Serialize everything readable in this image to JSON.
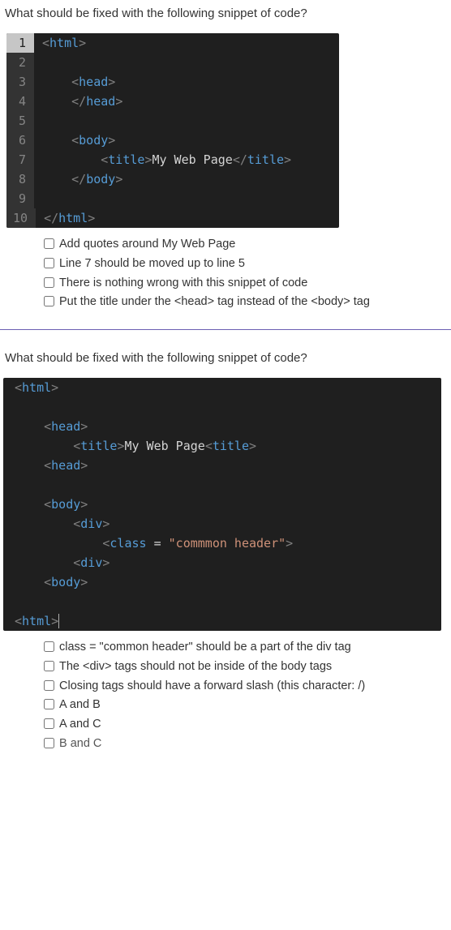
{
  "q1": {
    "prompt": "What should be fixed with the following snippet of code?",
    "code": {
      "lines": [
        "1",
        "2",
        "3",
        "4",
        "5",
        "6",
        "7",
        "8",
        "9",
        "10"
      ]
    },
    "options": [
      "Add quotes around My Web Page",
      "Line 7 should be moved up to line 5",
      "There is nothing wrong with this snippet of code",
      "Put the title under the <head> tag instead of the <body> tag"
    ]
  },
  "q2": {
    "prompt": "What should be fixed with the following snippet of code?",
    "options": [
      "class = \"common header\" should be a part of the div tag",
      "The <div> tags should not be inside of the body tags",
      "Closing tags should have a forward slash (this character: /)",
      "A and B",
      "A and C",
      "B and C"
    ]
  },
  "chart_data": {
    "type": "table",
    "title": "Code snippets (literal content shown in editor)",
    "snippet1": [
      "<html>",
      "",
      "    <head>",
      "    </head>",
      "",
      "    <body>",
      "        <title>My Web Page</title>",
      "    </body>",
      "",
      "</html>"
    ],
    "snippet2": [
      "<html>",
      "",
      "    <head>",
      "        <title>My Web Page<title>",
      "    <head>",
      "",
      "    <body>",
      "        <div>",
      "            <class = \"commmon header\">",
      "        <div>",
      "    <body>",
      "",
      "<html>"
    ]
  }
}
